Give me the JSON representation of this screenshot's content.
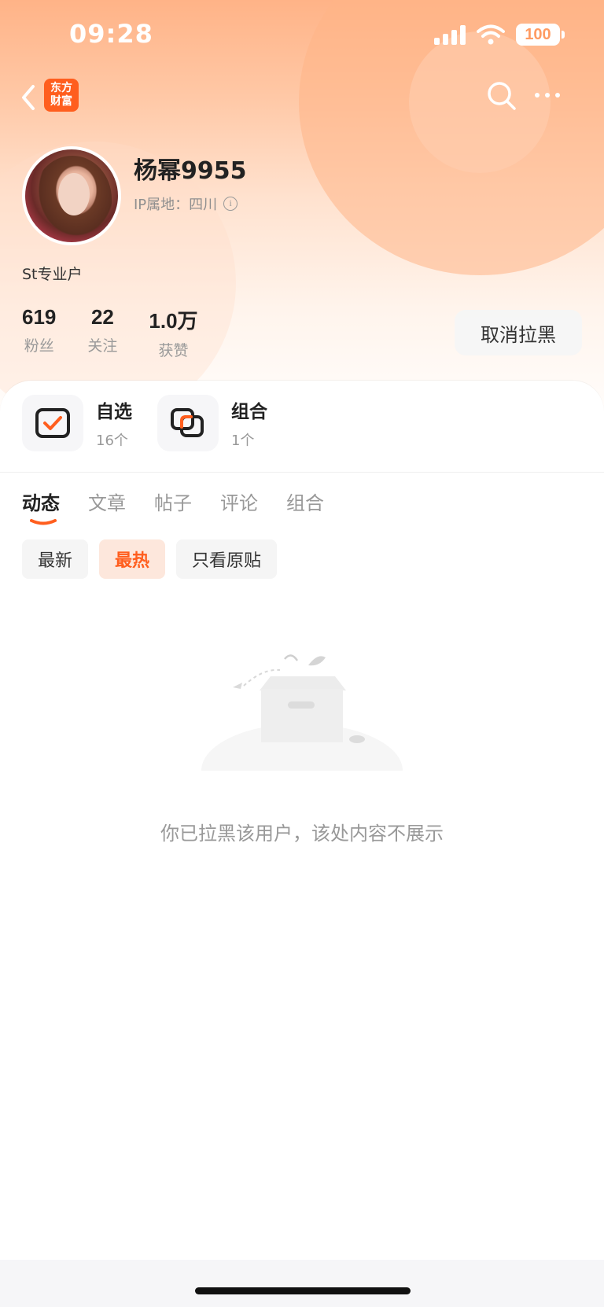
{
  "status_bar": {
    "time": "09:28",
    "battery": "100"
  },
  "nav": {
    "logo_line1": "东方",
    "logo_line2": "财富"
  },
  "profile": {
    "name": "杨幂9955",
    "ip_location": "IP属地：四川",
    "tag": "St专业户",
    "stats": [
      {
        "value": "619",
        "label": "粉丝"
      },
      {
        "value": "22",
        "label": "关注"
      },
      {
        "value": "1.0万",
        "label": "获赞"
      }
    ],
    "unblock_label": "取消拉黑"
  },
  "shortcuts": [
    {
      "title": "自选",
      "sub": "16个",
      "icon": "watchlist-icon"
    },
    {
      "title": "组合",
      "sub": "1个",
      "icon": "portfolio-icon"
    }
  ],
  "tabs": [
    "动态",
    "文章",
    "帖子",
    "评论",
    "组合"
  ],
  "filters": [
    "最新",
    "最热",
    "只看原贴"
  ],
  "empty_message": "你已拉黑该用户，该处内容不展示",
  "colors": {
    "accent": "#ff5e1e",
    "header_gradient_top": "#ffb387"
  }
}
